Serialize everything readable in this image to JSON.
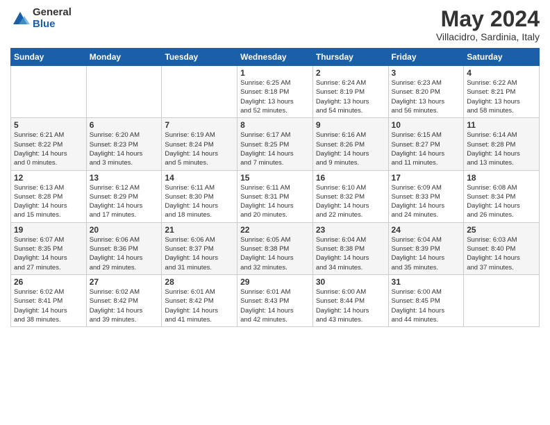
{
  "logo": {
    "general": "General",
    "blue": "Blue"
  },
  "header": {
    "title": "May 2024",
    "subtitle": "Villacidro, Sardinia, Italy"
  },
  "days_of_week": [
    "Sunday",
    "Monday",
    "Tuesday",
    "Wednesday",
    "Thursday",
    "Friday",
    "Saturday"
  ],
  "weeks": [
    [
      {
        "day": "",
        "info": ""
      },
      {
        "day": "",
        "info": ""
      },
      {
        "day": "",
        "info": ""
      },
      {
        "day": "1",
        "info": "Sunrise: 6:25 AM\nSunset: 8:18 PM\nDaylight: 13 hours\nand 52 minutes."
      },
      {
        "day": "2",
        "info": "Sunrise: 6:24 AM\nSunset: 8:19 PM\nDaylight: 13 hours\nand 54 minutes."
      },
      {
        "day": "3",
        "info": "Sunrise: 6:23 AM\nSunset: 8:20 PM\nDaylight: 13 hours\nand 56 minutes."
      },
      {
        "day": "4",
        "info": "Sunrise: 6:22 AM\nSunset: 8:21 PM\nDaylight: 13 hours\nand 58 minutes."
      }
    ],
    [
      {
        "day": "5",
        "info": "Sunrise: 6:21 AM\nSunset: 8:22 PM\nDaylight: 14 hours\nand 0 minutes."
      },
      {
        "day": "6",
        "info": "Sunrise: 6:20 AM\nSunset: 8:23 PM\nDaylight: 14 hours\nand 3 minutes."
      },
      {
        "day": "7",
        "info": "Sunrise: 6:19 AM\nSunset: 8:24 PM\nDaylight: 14 hours\nand 5 minutes."
      },
      {
        "day": "8",
        "info": "Sunrise: 6:17 AM\nSunset: 8:25 PM\nDaylight: 14 hours\nand 7 minutes."
      },
      {
        "day": "9",
        "info": "Sunrise: 6:16 AM\nSunset: 8:26 PM\nDaylight: 14 hours\nand 9 minutes."
      },
      {
        "day": "10",
        "info": "Sunrise: 6:15 AM\nSunset: 8:27 PM\nDaylight: 14 hours\nand 11 minutes."
      },
      {
        "day": "11",
        "info": "Sunrise: 6:14 AM\nSunset: 8:28 PM\nDaylight: 14 hours\nand 13 minutes."
      }
    ],
    [
      {
        "day": "12",
        "info": "Sunrise: 6:13 AM\nSunset: 8:28 PM\nDaylight: 14 hours\nand 15 minutes."
      },
      {
        "day": "13",
        "info": "Sunrise: 6:12 AM\nSunset: 8:29 PM\nDaylight: 14 hours\nand 17 minutes."
      },
      {
        "day": "14",
        "info": "Sunrise: 6:11 AM\nSunset: 8:30 PM\nDaylight: 14 hours\nand 18 minutes."
      },
      {
        "day": "15",
        "info": "Sunrise: 6:11 AM\nSunset: 8:31 PM\nDaylight: 14 hours\nand 20 minutes."
      },
      {
        "day": "16",
        "info": "Sunrise: 6:10 AM\nSunset: 8:32 PM\nDaylight: 14 hours\nand 22 minutes."
      },
      {
        "day": "17",
        "info": "Sunrise: 6:09 AM\nSunset: 8:33 PM\nDaylight: 14 hours\nand 24 minutes."
      },
      {
        "day": "18",
        "info": "Sunrise: 6:08 AM\nSunset: 8:34 PM\nDaylight: 14 hours\nand 26 minutes."
      }
    ],
    [
      {
        "day": "19",
        "info": "Sunrise: 6:07 AM\nSunset: 8:35 PM\nDaylight: 14 hours\nand 27 minutes."
      },
      {
        "day": "20",
        "info": "Sunrise: 6:06 AM\nSunset: 8:36 PM\nDaylight: 14 hours\nand 29 minutes."
      },
      {
        "day": "21",
        "info": "Sunrise: 6:06 AM\nSunset: 8:37 PM\nDaylight: 14 hours\nand 31 minutes."
      },
      {
        "day": "22",
        "info": "Sunrise: 6:05 AM\nSunset: 8:38 PM\nDaylight: 14 hours\nand 32 minutes."
      },
      {
        "day": "23",
        "info": "Sunrise: 6:04 AM\nSunset: 8:38 PM\nDaylight: 14 hours\nand 34 minutes."
      },
      {
        "day": "24",
        "info": "Sunrise: 6:04 AM\nSunset: 8:39 PM\nDaylight: 14 hours\nand 35 minutes."
      },
      {
        "day": "25",
        "info": "Sunrise: 6:03 AM\nSunset: 8:40 PM\nDaylight: 14 hours\nand 37 minutes."
      }
    ],
    [
      {
        "day": "26",
        "info": "Sunrise: 6:02 AM\nSunset: 8:41 PM\nDaylight: 14 hours\nand 38 minutes."
      },
      {
        "day": "27",
        "info": "Sunrise: 6:02 AM\nSunset: 8:42 PM\nDaylight: 14 hours\nand 39 minutes."
      },
      {
        "day": "28",
        "info": "Sunrise: 6:01 AM\nSunset: 8:42 PM\nDaylight: 14 hours\nand 41 minutes."
      },
      {
        "day": "29",
        "info": "Sunrise: 6:01 AM\nSunset: 8:43 PM\nDaylight: 14 hours\nand 42 minutes."
      },
      {
        "day": "30",
        "info": "Sunrise: 6:00 AM\nSunset: 8:44 PM\nDaylight: 14 hours\nand 43 minutes."
      },
      {
        "day": "31",
        "info": "Sunrise: 6:00 AM\nSunset: 8:45 PM\nDaylight: 14 hours\nand 44 minutes."
      },
      {
        "day": "",
        "info": ""
      }
    ]
  ]
}
